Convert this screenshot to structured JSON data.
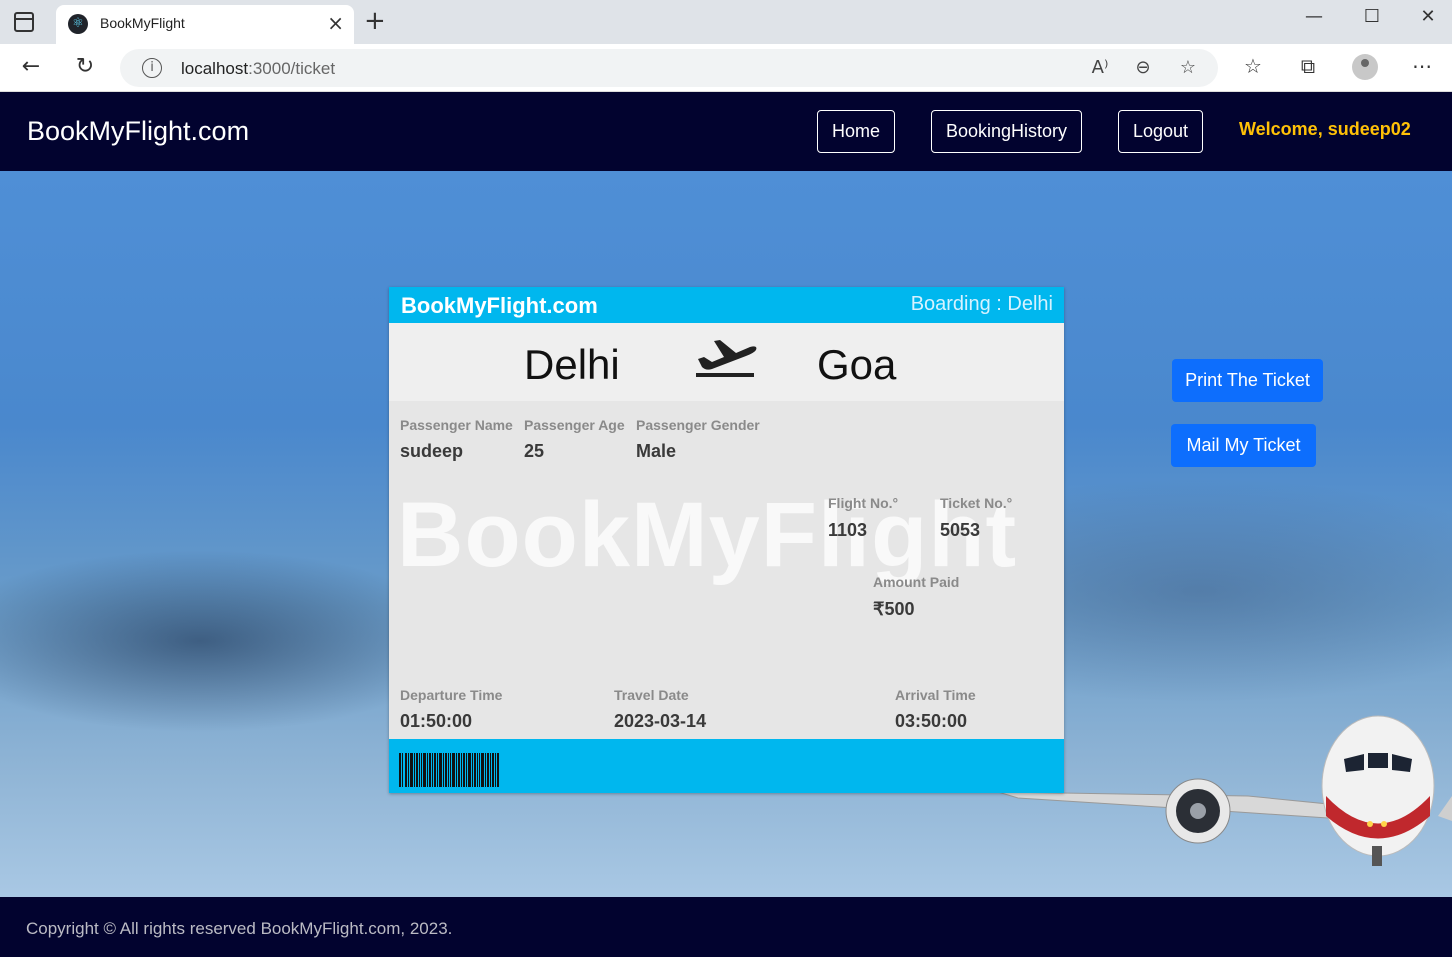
{
  "browser": {
    "tab_title": "BookMyFlight",
    "url_host": "localhost",
    "url_path": ":3000/ticket"
  },
  "navbar": {
    "brand": "BookMyFlight.com",
    "links": {
      "home": "Home",
      "history": "BookingHistory",
      "logout": "Logout"
    },
    "welcome": "Welcome, sudeep02"
  },
  "ticket": {
    "brand": "BookMyFlight.com",
    "boarding": "Boarding : Delhi",
    "from": "Delhi",
    "to": "Goa",
    "watermark": "BookMyFlight",
    "passenger_name_label": "Passenger Name",
    "passenger_name": "sudeep",
    "passenger_age_label": "Passenger Age",
    "passenger_age": "25",
    "passenger_gender_label": "Passenger Gender",
    "passenger_gender": "Male",
    "flight_no_label": "Flight No.°",
    "flight_no": "1103",
    "ticket_no_label": "Ticket No.°",
    "ticket_no": "5053",
    "amount_label": "Amount Paid",
    "amount": "₹500",
    "departure_label": "Departure Time",
    "departure": "01:50:00",
    "travel_date_label": "Travel Date",
    "travel_date": "2023-03-14",
    "arrival_label": "Arrival Time",
    "arrival": "03:50:00"
  },
  "actions": {
    "print": "Print The Ticket",
    "mail": "Mail My Ticket"
  },
  "footer": {
    "copyright": "Copyright © All rights reserved BookMyFlight.com, 2023."
  },
  "colors": {
    "navbar_bg": "#02032f",
    "ticket_accent": "#00b7ee",
    "welcome": "#ffc107",
    "primary_button": "#0d6efd"
  }
}
